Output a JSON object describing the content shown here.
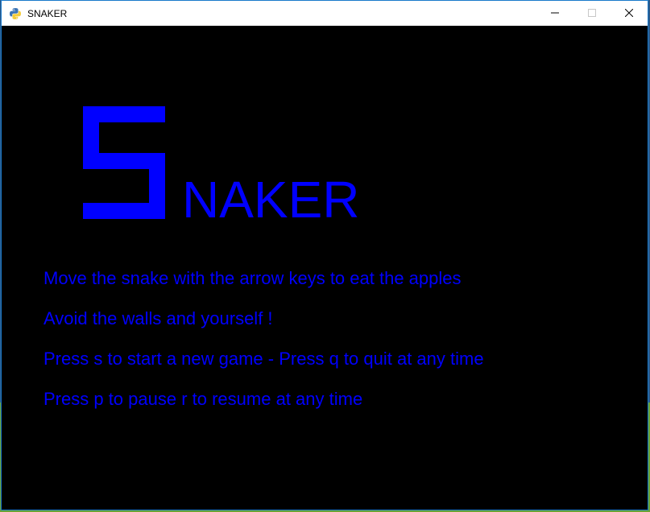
{
  "window": {
    "title": "SNAKER"
  },
  "icons": {
    "app": "python-icon",
    "minimize": "minimize-icon",
    "maximize": "maximize-icon",
    "close": "close-icon"
  },
  "logo": {
    "first_letter": "S",
    "rest": "NAKER"
  },
  "instructions": [
    "Move the snake with the arrow keys to eat the apples",
    "Avoid the walls and yourself !",
    "Press s to start a new game - Press q to quit at any time",
    "Press p to pause r to resume at any time"
  ],
  "colors": {
    "text": "#0000ff",
    "background": "#000000"
  }
}
